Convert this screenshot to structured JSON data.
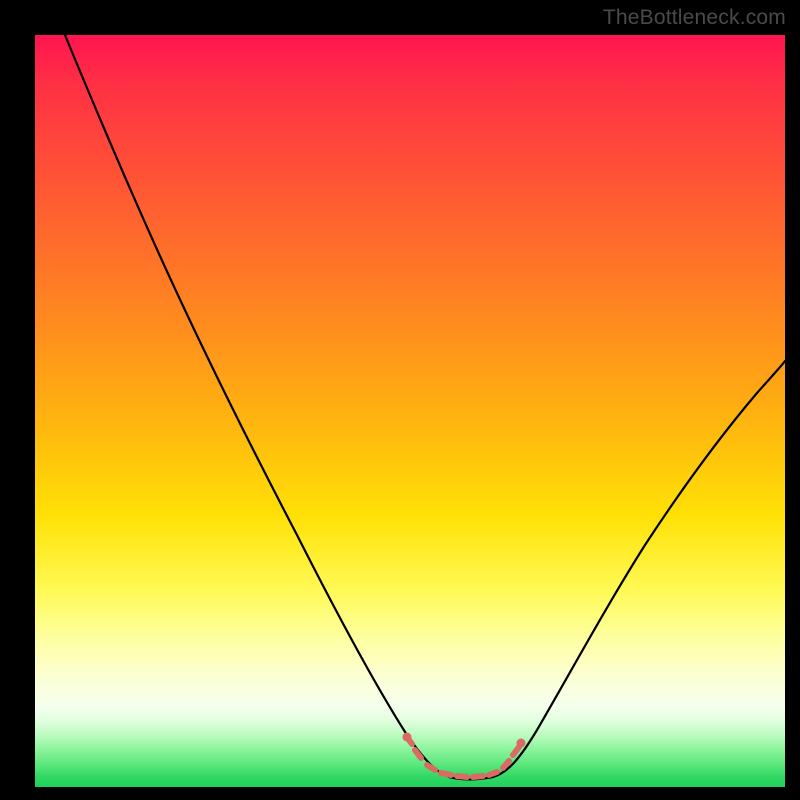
{
  "watermark": "TheBottleneck.com",
  "colors": {
    "background": "#000000",
    "curve": "#000000",
    "marker": "#D96A64",
    "gradient_top": "#FF1450",
    "gradient_bottom": "#1FCF5A"
  },
  "chart_data": {
    "type": "line",
    "title": "",
    "xlabel": "",
    "ylabel": "",
    "xlim": [
      0,
      100
    ],
    "ylim": [
      0,
      100
    ],
    "grid": false,
    "legend": false,
    "note": "No axis ticks or numeric labels are shown in the image; values below are estimated from curve geometry relative to the plot box (0–100 normalized).",
    "series": [
      {
        "name": "bottleneck-curve",
        "x": [
          4,
          10,
          16,
          22,
          28,
          34,
          40,
          45,
          49,
          52,
          55,
          58,
          61,
          64,
          70,
          76,
          82,
          88,
          94,
          100
        ],
        "y": [
          100,
          88,
          76,
          64,
          52,
          40,
          28,
          16,
          6,
          1,
          0,
          0,
          1,
          4,
          12,
          22,
          32,
          42,
          51,
          60
        ]
      }
    ],
    "highlight_band": {
      "description": "red dotted/segmented horizontal band marking the curve minimum region",
      "x_range": [
        49,
        62
      ],
      "y": 2
    }
  }
}
